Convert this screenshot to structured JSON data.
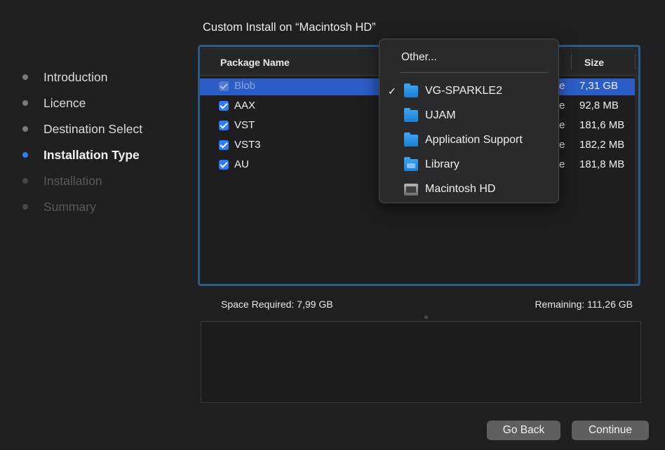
{
  "window": {
    "title": "Custom Install on “Macintosh HD”"
  },
  "steps": [
    {
      "label": "Introduction",
      "state": "done"
    },
    {
      "label": "Licence",
      "state": "done"
    },
    {
      "label": "Destination Select",
      "state": "done"
    },
    {
      "label": "Installation Type",
      "state": "active"
    },
    {
      "label": "Installation",
      "state": "disabled"
    },
    {
      "label": "Summary",
      "state": "disabled"
    }
  ],
  "table": {
    "col_package": "Package Name",
    "col_size": "Size",
    "rows": [
      {
        "name": "Blob",
        "partial": "e",
        "size": "7,31 GB",
        "checked": true,
        "selected": true
      },
      {
        "name": "AAX",
        "partial": "e",
        "size": "92,8 MB",
        "checked": true
      },
      {
        "name": "VST",
        "partial": "e",
        "size": "181,6 MB",
        "checked": true
      },
      {
        "name": "VST3",
        "partial": "e",
        "size": "182,2 MB",
        "checked": true
      },
      {
        "name": "AU",
        "partial": "e",
        "size": "181,8 MB",
        "checked": true
      }
    ]
  },
  "footer": {
    "space_required": "Space Required:  7,99 GB",
    "remaining": "Remaining:  111,26 GB"
  },
  "buttons": {
    "back": "Go Back",
    "continue": "Continue"
  },
  "popup": {
    "other": "Other...",
    "items": [
      {
        "label": "VG-SPARKLE2",
        "icon": "folder-icon",
        "checked": true
      },
      {
        "label": "UJAM",
        "icon": "folder-icon"
      },
      {
        "label": "Application Support",
        "icon": "folder-icon"
      },
      {
        "label": "Library",
        "icon": "library-folder-icon"
      },
      {
        "label": "Macintosh HD",
        "icon": "hard-drive-icon"
      }
    ],
    "checkmark": "✓"
  },
  "colors": {
    "accent": "#2f7cf6",
    "selection": "#2c5cc5",
    "folder": "#1b7fd3"
  }
}
